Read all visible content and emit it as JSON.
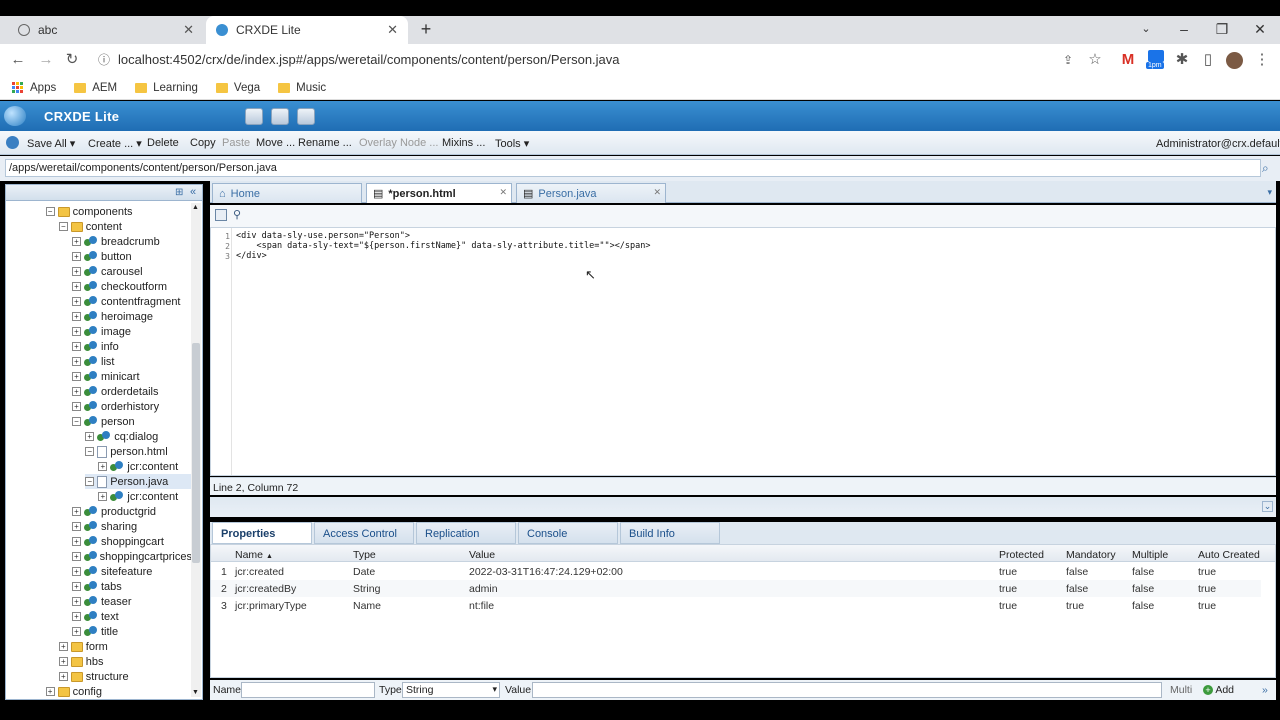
{
  "browser": {
    "tabs": [
      {
        "title": "abc",
        "active": false
      },
      {
        "title": "CRXDE Lite",
        "active": true
      }
    ],
    "url": "localhost:4502/crx/de/index.jsp#/apps/weretail/components/content/person/Person.java",
    "bookmarks": [
      "Apps",
      "AEM",
      "Learning",
      "Vega",
      "Music"
    ],
    "calendar_badge": "1pm"
  },
  "app": {
    "title": "CRXDE Lite",
    "toolbar": {
      "save_all": "Save All",
      "create": "Create ...",
      "delete": "Delete",
      "copy": "Copy",
      "paste": "Paste",
      "move": "Move ...",
      "rename": "Rename ...",
      "overlay": "Overlay Node ...",
      "mixins": "Mixins ...",
      "tools": "Tools",
      "user": "Administrator@crx.default"
    },
    "path": "/apps/weretail/components/content/person/Person.java"
  },
  "tree": [
    {
      "label": "components",
      "type": "folder",
      "exp": "-"
    },
    {
      "label": "content",
      "type": "folder",
      "exp": "-"
    },
    {
      "label": "breadcrumb",
      "type": "comp",
      "exp": "+"
    },
    {
      "label": "button",
      "type": "comp",
      "exp": "+"
    },
    {
      "label": "carousel",
      "type": "comp",
      "exp": "+"
    },
    {
      "label": "checkoutform",
      "type": "comp",
      "exp": "+"
    },
    {
      "label": "contentfragment",
      "type": "comp",
      "exp": "+"
    },
    {
      "label": "heroimage",
      "type": "comp",
      "exp": "+"
    },
    {
      "label": "image",
      "type": "comp",
      "exp": "+"
    },
    {
      "label": "info",
      "type": "comp",
      "exp": "+"
    },
    {
      "label": "list",
      "type": "comp",
      "exp": "+"
    },
    {
      "label": "minicart",
      "type": "comp",
      "exp": "+"
    },
    {
      "label": "orderdetails",
      "type": "comp",
      "exp": "+"
    },
    {
      "label": "orderhistory",
      "type": "comp",
      "exp": "+"
    },
    {
      "label": "person",
      "type": "comp",
      "exp": "-"
    },
    {
      "label": "cq:dialog",
      "type": "comp",
      "exp": "+"
    },
    {
      "label": "person.html",
      "type": "doc",
      "exp": "-"
    },
    {
      "label": "jcr:content",
      "type": "comp",
      "exp": "+"
    },
    {
      "label": "Person.java",
      "type": "doc",
      "exp": "-",
      "selected": true
    },
    {
      "label": "jcr:content",
      "type": "comp",
      "exp": "+"
    },
    {
      "label": "productgrid",
      "type": "comp",
      "exp": "+"
    },
    {
      "label": "sharing",
      "type": "comp",
      "exp": "+"
    },
    {
      "label": "shoppingcart",
      "type": "comp",
      "exp": "+"
    },
    {
      "label": "shoppingcartprices",
      "type": "comp",
      "exp": "+"
    },
    {
      "label": "sitefeature",
      "type": "comp",
      "exp": "+"
    },
    {
      "label": "tabs",
      "type": "comp",
      "exp": "+"
    },
    {
      "label": "teaser",
      "type": "comp",
      "exp": "+"
    },
    {
      "label": "text",
      "type": "comp",
      "exp": "+"
    },
    {
      "label": "title",
      "type": "comp",
      "exp": "+"
    },
    {
      "label": "form",
      "type": "folder",
      "exp": "+"
    },
    {
      "label": "hbs",
      "type": "folder",
      "exp": "+"
    },
    {
      "label": "structure",
      "type": "folder",
      "exp": "+"
    },
    {
      "label": "config",
      "type": "folder",
      "exp": "+"
    }
  ],
  "editor": {
    "tabs": [
      {
        "label": "Home"
      },
      {
        "label": "*person.html",
        "active": true
      },
      {
        "label": "Person.java"
      }
    ],
    "code_lines": [
      "<div data-sly-use.person=\"Person\">",
      "    <span data-sly-text=\"${person.firstName}\" data-sly-attribute.title=\"\"></span>",
      "</div>"
    ],
    "status": "Line 2, Column 72"
  },
  "properties": {
    "tabs": [
      "Properties",
      "Access Control",
      "Replication",
      "Console",
      "Build Info"
    ],
    "columns": [
      "Name",
      "Type",
      "Value",
      "Protected",
      "Mandatory",
      "Multiple",
      "Auto Created"
    ],
    "rows": [
      [
        "1",
        "jcr:created",
        "Date",
        "2022-03-31T16:47:24.129+02:00",
        "true",
        "false",
        "false",
        "true"
      ],
      [
        "2",
        "jcr:createdBy",
        "String",
        "admin",
        "true",
        "false",
        "false",
        "true"
      ],
      [
        "3",
        "jcr:primaryType",
        "Name",
        "nt:file",
        "true",
        "true",
        "false",
        "true"
      ]
    ],
    "add": {
      "name_label": "Name",
      "type_label": "Type",
      "type_value": "String",
      "value_label": "Value",
      "multi_label": "Multi",
      "add_label": "Add"
    }
  }
}
